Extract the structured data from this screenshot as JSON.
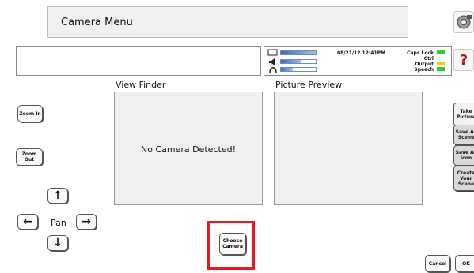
{
  "header": {
    "title": "Camera Menu"
  },
  "top_right": {
    "settings_icon": "gear-camera-icon",
    "help_label": "?",
    "help_color": "#c1121f"
  },
  "status": {
    "timestamp": "08/21/12 12:41PM",
    "caps_lock": "Caps Lock",
    "ctrl": "Ctrl",
    "output": "Output",
    "speech": "Speech",
    "indicator_colors": {
      "caps_lock": "#33cc33",
      "output": "#e6d300",
      "speech": "#33cc33"
    }
  },
  "sections": {
    "view_finder": {
      "title": "View Finder",
      "message": "No Camera Detected!"
    },
    "picture_preview": {
      "title": "Picture Preview"
    }
  },
  "controls": {
    "zoom_in": "Zoom In",
    "zoom_out": "Zoom Out",
    "pan": "Pan",
    "up": "↑",
    "down": "↓",
    "left": "←",
    "right": "→",
    "choose_camera": "Choose Camera"
  },
  "side_buttons": [
    {
      "label": "Take Picture"
    },
    {
      "label": "Save As Scene"
    },
    {
      "label": "Save As Icon"
    },
    {
      "label": "Create Your Scene"
    }
  ],
  "bottom": {
    "cancel": "Cancel",
    "ok": "OK"
  }
}
